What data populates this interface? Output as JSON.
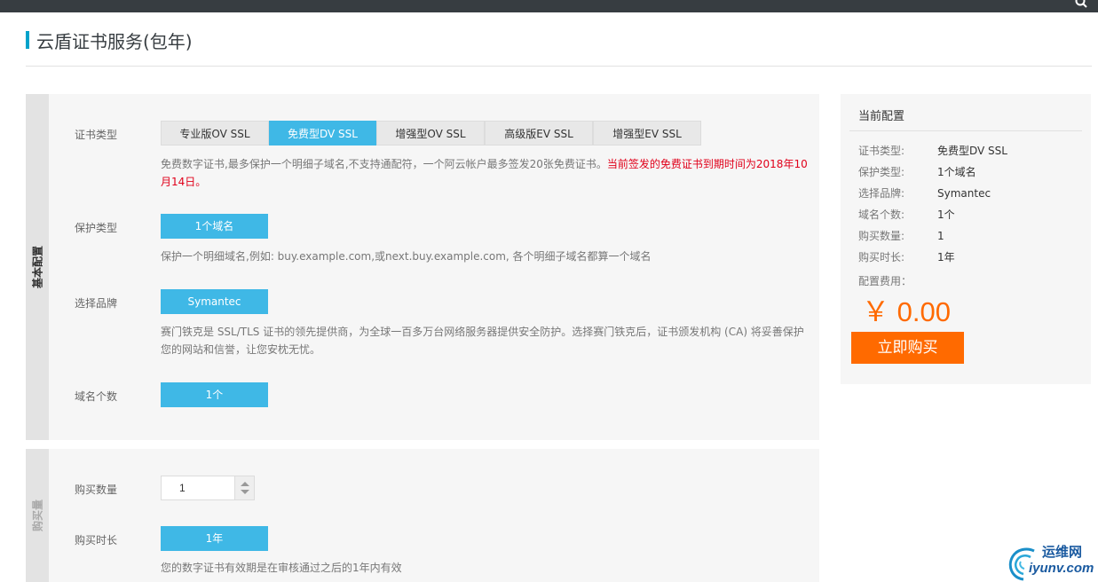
{
  "page": {
    "title": "云盾证书服务(包年)"
  },
  "colors": {
    "accent": "#3fb8e6",
    "price": "#ff6a00",
    "warning": "#e0001a",
    "topbar": "#373d41"
  },
  "basic": {
    "tab_label": "基本配置",
    "cert_type": {
      "label": "证书类型",
      "options": [
        "专业版OV SSL",
        "免费型DV SSL",
        "增强型OV SSL",
        "高级版EV SSL",
        "增强型EV SSL"
      ],
      "selected": "免费型DV SSL",
      "desc_line1": "免费数字证书,最多保护一个明细子域名,不支持通配符，一个阿云帐户最多签发20张免费证书。",
      "desc_warning1": "当前签发的免费证书到期时间为2018年10",
      "desc_warning2": "月14日。"
    },
    "protect_type": {
      "label": "保护类型",
      "value": "1个域名",
      "desc": "保护一个明细域名,例如: buy.example.com,或next.buy.example.com, 各个明细子域名都算一个域名"
    },
    "brand": {
      "label": "选择品牌",
      "value": "Symantec",
      "desc_line1": "赛门铁克是 SSL/TLS 证书的领先提供商，为全球一百多万台网络服务器提供安全防护。选择赛门铁克后，证书颁发机构 (CA) 将妥善保护",
      "desc_line2": "您的网站和信誉，让您安枕无忧。"
    },
    "domain_count": {
      "label": "域名个数",
      "value": "1个"
    }
  },
  "purchase": {
    "tab_label": "购买量",
    "quantity": {
      "label": "购买数量",
      "value": "1"
    },
    "duration": {
      "label": "购买时长",
      "value": "1年",
      "desc": "您的数字证书有效期是在审核通过之后的1年内有效"
    }
  },
  "summary": {
    "title": "当前配置",
    "rows": [
      {
        "key": "证书类型:",
        "value": "免费型DV SSL"
      },
      {
        "key": "保护类型:",
        "value": "1个域名"
      },
      {
        "key": "选择品牌:",
        "value": "Symantec"
      },
      {
        "key": "域名个数:",
        "value": "1个"
      },
      {
        "key": "购买数量:",
        "value": "1"
      },
      {
        "key": "购买时长:",
        "value": "1年"
      }
    ],
    "fee_label": "配置费用：",
    "price": "￥ 0.00",
    "buy_label": "立即购买"
  },
  "watermark": {
    "line1": "运维网",
    "line2": "iyunv.com"
  }
}
